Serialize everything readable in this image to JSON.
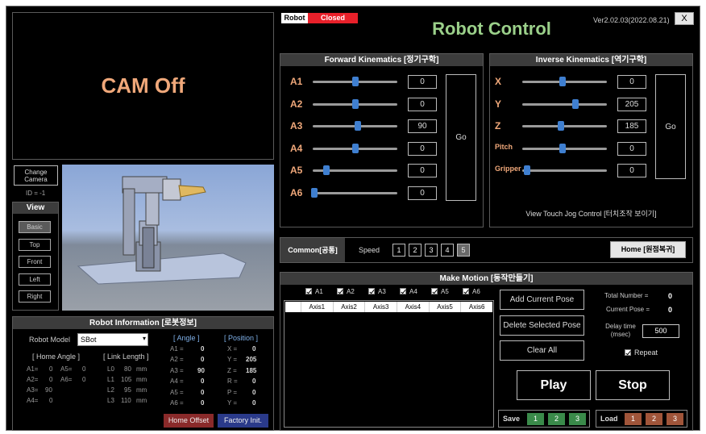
{
  "camera": {
    "status": "CAM Off",
    "change_label": "Change Camera",
    "id_text": "ID = -1"
  },
  "view": {
    "title": "View",
    "buttons": [
      "Basic",
      "Top",
      "Front",
      "Left",
      "Right"
    ]
  },
  "robot_info": {
    "title": "Robot Information [로봇정보]",
    "model_label": "Robot Model",
    "model_value": "SBot",
    "home_angle_title": "[ Home Angle ]",
    "home_angles": [
      {
        "k": "A1=",
        "v": "0"
      },
      {
        "k": "A5=",
        "v": "0"
      },
      {
        "k": "A2=",
        "v": "0"
      },
      {
        "k": "A6=",
        "v": "0"
      },
      {
        "k": "A3=",
        "v": "90"
      },
      {
        "k": "A4=",
        "v": "0"
      }
    ],
    "link_title": "[ Link Length ]",
    "links": [
      {
        "k": "L0",
        "v": "80",
        "u": "mm"
      },
      {
        "k": "L1",
        "v": "105",
        "u": "mm"
      },
      {
        "k": "L2",
        "v": "95",
        "u": "mm"
      },
      {
        "k": "L3",
        "v": "110",
        "u": "mm"
      }
    ],
    "angle_title": "[ Angle ]",
    "angles": [
      {
        "k": "A1 =",
        "v": "0"
      },
      {
        "k": "A2 =",
        "v": "0"
      },
      {
        "k": "A3 =",
        "v": "90"
      },
      {
        "k": "A4 =",
        "v": "0"
      },
      {
        "k": "A5 =",
        "v": "0"
      },
      {
        "k": "A6 =",
        "v": "0"
      }
    ],
    "position_title": "[ Position ]",
    "positions": [
      {
        "k": "X =",
        "v": "0"
      },
      {
        "k": "Y =",
        "v": "205"
      },
      {
        "k": "Z =",
        "v": "185"
      },
      {
        "k": "R =",
        "v": "0"
      },
      {
        "k": "P =",
        "v": "0"
      },
      {
        "k": "Y =",
        "v": "0"
      }
    ],
    "home_offset_label": "Home Offset",
    "factory_init_label": "Factory Init."
  },
  "header": {
    "robot_label": "Robot",
    "robot_status": "Closed",
    "title": "Robot Control",
    "version": "Ver2.02.03(2022.08.21)",
    "close_label": "X"
  },
  "forward_kinematics": {
    "title": "Forward Kinematics [정기구학]",
    "go_label": "Go",
    "rows": [
      {
        "label": "A1",
        "value": "0",
        "level": 0.5
      },
      {
        "label": "A2",
        "value": "0",
        "level": 0.5
      },
      {
        "label": "A3",
        "value": "90",
        "level": 0.53
      },
      {
        "label": "A4",
        "value": "0",
        "level": 0.5
      },
      {
        "label": "A5",
        "value": "0",
        "level": 0.16
      },
      {
        "label": "A6",
        "value": "0",
        "level": 0.02
      }
    ]
  },
  "inverse_kinematics": {
    "title": "Inverse Kinematics [역기구학]",
    "go_label": "Go",
    "rows": [
      {
        "label": "X",
        "value": "0",
        "level": 0.48
      },
      {
        "label": "Y",
        "value": "205",
        "level": 0.63
      },
      {
        "label": "Z",
        "value": "185",
        "level": 0.46
      },
      {
        "label": "Pitch",
        "value": "0",
        "level": 0.48
      },
      {
        "label": "Gripper",
        "value": "0",
        "level": 0.06
      }
    ],
    "touch_jog_label": "View Touch Jog Control [터치조작 보이기]"
  },
  "common": {
    "title": "Common[공통]",
    "speed_label": "Speed",
    "speeds": [
      "1",
      "2",
      "3",
      "4",
      "5"
    ],
    "selected_speed": "5",
    "home_label": "Home [원점복귀]"
  },
  "make_motion": {
    "title": "Make Motion [동작만들기]",
    "axes_checks": [
      "A1",
      "A2",
      "A3",
      "A4",
      "A5",
      "A6"
    ],
    "columns": [
      "Axis1",
      "Axis2",
      "Axis3",
      "Axis4",
      "Axis5",
      "Axis6"
    ],
    "add_label": "Add Current Pose",
    "delete_label": "Delete Selected Pose",
    "clear_label": "Clear All",
    "total_label": "Total Number  =",
    "total_value": "0",
    "current_label": "Current Pose  =",
    "current_value": "0",
    "delay_label": "Delay time\n(msec)",
    "delay_value": "500",
    "repeat_label": "Repeat",
    "play_label": "Play",
    "stop_label": "Stop",
    "save_label": "Save",
    "save_slots": [
      "1",
      "2",
      "3"
    ],
    "load_label": "Load",
    "load_slots": [
      "1",
      "2",
      "3"
    ]
  },
  "colors": {
    "accent_green": "#9bd08a",
    "label_orange": "#f0a87a",
    "status_red": "#e8202a",
    "save_green": "#3a8a4a",
    "load_brown": "#a0553a",
    "home_offset_red": "#8a2a2a",
    "factory_blue": "#2a3a8a"
  }
}
